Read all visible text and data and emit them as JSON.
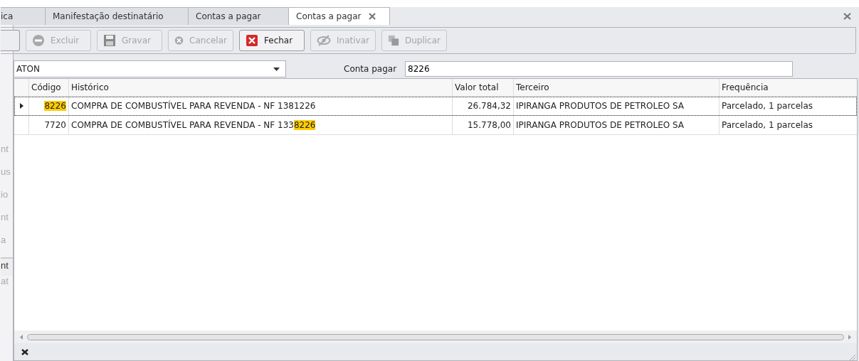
{
  "tabs": [
    {
      "label": "ica",
      "selected": false,
      "closable": false
    },
    {
      "label": "Manifestação destinatário",
      "selected": false,
      "closable": false
    },
    {
      "label": "Contas a pagar",
      "selected": false,
      "closable": false
    },
    {
      "label": "Contas a pagar",
      "selected": true,
      "closable": true
    }
  ],
  "toolbar": [
    {
      "kind": "partial"
    },
    {
      "kind": "minus",
      "label": "Excluir",
      "disabled": true
    },
    {
      "kind": "save",
      "label": "Gravar",
      "disabled": true
    },
    {
      "kind": "cancel",
      "label": "Cancelar",
      "disabled": true
    },
    {
      "kind": "close",
      "label": "Fechar",
      "disabled": false
    },
    {
      "kind": "hide",
      "label": "Inativar",
      "disabled": true
    },
    {
      "kind": "copy",
      "label": "Duplicar",
      "disabled": true
    }
  ],
  "side_fragments": [
    "nt",
    "us",
    "io",
    "nt",
    "a",
    "nt",
    "at"
  ],
  "filter": {
    "company": "ATON",
    "account_label": "Conta pagar",
    "account_value": "8226"
  },
  "table": {
    "columns": [
      "Código",
      "Histórico",
      "Valor total",
      "Terceiro",
      "Frequência"
    ],
    "rows": [
      {
        "selected": true,
        "cells": [
          [
            {
              "text": "8226",
              "highlight": true
            }
          ],
          [
            {
              "text": "COMPRA DE COMBUSTÍVEL PARA REVENDA - NF 1381226",
              "highlight": false
            }
          ],
          [
            {
              "text": "26.784,32",
              "highlight": false
            }
          ],
          [
            {
              "text": "IPIRANGA PRODUTOS DE PETROLEO SA",
              "highlight": false
            }
          ],
          [
            {
              "text": "Parcelado, 1 parcelas",
              "highlight": false
            }
          ]
        ]
      },
      {
        "selected": false,
        "cells": [
          [
            {
              "text": "7720",
              "highlight": false
            }
          ],
          [
            {
              "text": "COMPRA DE COMBUSTÍVEL PARA REVENDA - NF 133",
              "highlight": false
            },
            {
              "text": "8226",
              "highlight": true
            }
          ],
          [
            {
              "text": "15.778,00",
              "highlight": false
            }
          ],
          [
            {
              "text": "IPIRANGA PRODUTOS DE PETROLEO SA",
              "highlight": false
            }
          ],
          [
            {
              "text": "Parcelado, 1 parcelas",
              "highlight": false
            }
          ]
        ]
      }
    ]
  }
}
